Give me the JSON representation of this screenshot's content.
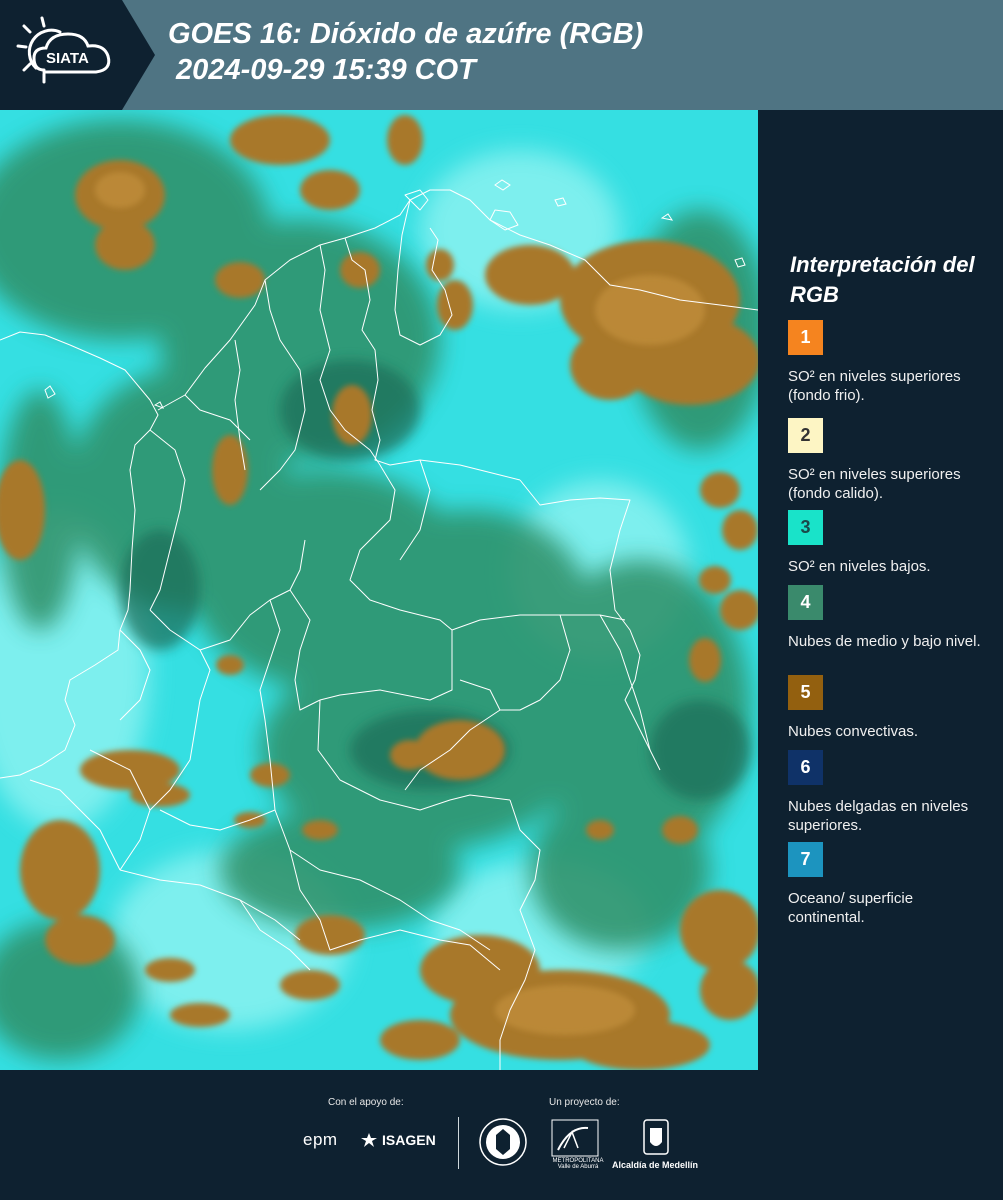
{
  "header": {
    "logo_text": "SIATA",
    "title_line1": "GOES 16: Dióxido de azúfre (RGB)",
    "title_line2": " 2024-09-29 15:39 COT"
  },
  "legend": {
    "title": "Interpretación del RGB",
    "items": [
      {
        "number": "1",
        "color": "#f5841f",
        "text_color": "#ffffff",
        "description": "SO² en niveles superiores (fondo frio)."
      },
      {
        "number": "2",
        "color": "#fdf5c4",
        "text_color": "#333333",
        "description": "SO² en niveles superiores (fondo calido)."
      },
      {
        "number": "3",
        "color": "#19e3c9",
        "text_color": "#1a4a4a",
        "description": "SO² en niveles bajos."
      },
      {
        "number": "4",
        "color": "#3a8a6c",
        "text_color": "#ffffff",
        "description": "Nubes de medio y bajo nivel."
      },
      {
        "number": "5",
        "color": "#93600f",
        "text_color": "#ffffff",
        "description": "Nubes convectivas."
      },
      {
        "number": "6",
        "color": "#0f3268",
        "text_color": "#ffffff",
        "description": "Nubes delgadas en niveles superiores."
      },
      {
        "number": "7",
        "color": "#1c94bf",
        "text_color": "#ffffff",
        "description": "Oceano/ superficie continental."
      }
    ]
  },
  "map_colors": {
    "background": "#2fe0e4",
    "low_cloud": "#2f8f66",
    "convective": "#a8782a",
    "borders": "#ffffff"
  },
  "footer": {
    "support_label": "Con el apoyo de:",
    "epm_text": "epm",
    "isagen_text": "ISAGEN",
    "project_label": "Un proyecto de:",
    "area_text": "METROPOLITANA Valle de Aburrá",
    "alcaldia_text": "Alcaldía de Medellín"
  }
}
